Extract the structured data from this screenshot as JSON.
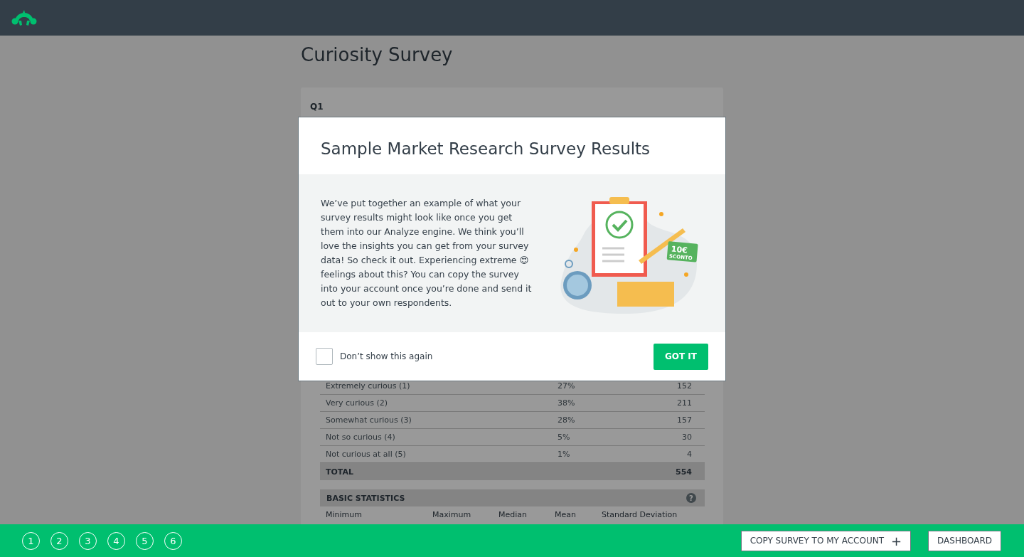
{
  "survey": {
    "title": "Curiosity Survey",
    "question_label": "Q1",
    "rows": [
      {
        "answer": "Extremely curious (1)",
        "percent": "27%",
        "count": "152"
      },
      {
        "answer": "Very curious (2)",
        "percent": "38%",
        "count": "211"
      },
      {
        "answer": "Somewhat curious (3)",
        "percent": "28%",
        "count": "157"
      },
      {
        "answer": "Not so curious (4)",
        "percent": "5%",
        "count": "30"
      },
      {
        "answer": "Not curious at all (5)",
        "percent": "1%",
        "count": "4"
      }
    ],
    "total": {
      "label": "TOTAL",
      "count": "554"
    },
    "statistics": {
      "title": "BASIC STATISTICS",
      "help_icon": "?",
      "columns": [
        "Minimum",
        "Maximum",
        "Median",
        "Mean",
        "Standard Deviation"
      ]
    }
  },
  "modal": {
    "title": "Sample Market Research Survey Results",
    "body": "We’ve put together an example of what your survey results might look like once you get them into our Analyze engine. We think you’ll love the insights you can get from your survey data! So check it out. Experiencing extreme 😍 feelings about this? You can copy the survey into your account once you’re done and send it out to your own respondents.",
    "illustration": {
      "voucher_amount": "10€",
      "voucher_label": "SCONTO"
    },
    "checkbox": {
      "label": "Don’t show this again",
      "checked": false
    },
    "button": "GOT IT"
  },
  "footer": {
    "steps": [
      {
        "label": "1"
      },
      {
        "label": "2"
      },
      {
        "label": "3"
      },
      {
        "label": "4"
      },
      {
        "label": "5"
      },
      {
        "label": "6"
      }
    ],
    "copy_button": {
      "label": "COPY SURVEY TO MY ACCOUNT",
      "icon": "+"
    },
    "dashboard_button": "DASHBOARD"
  }
}
